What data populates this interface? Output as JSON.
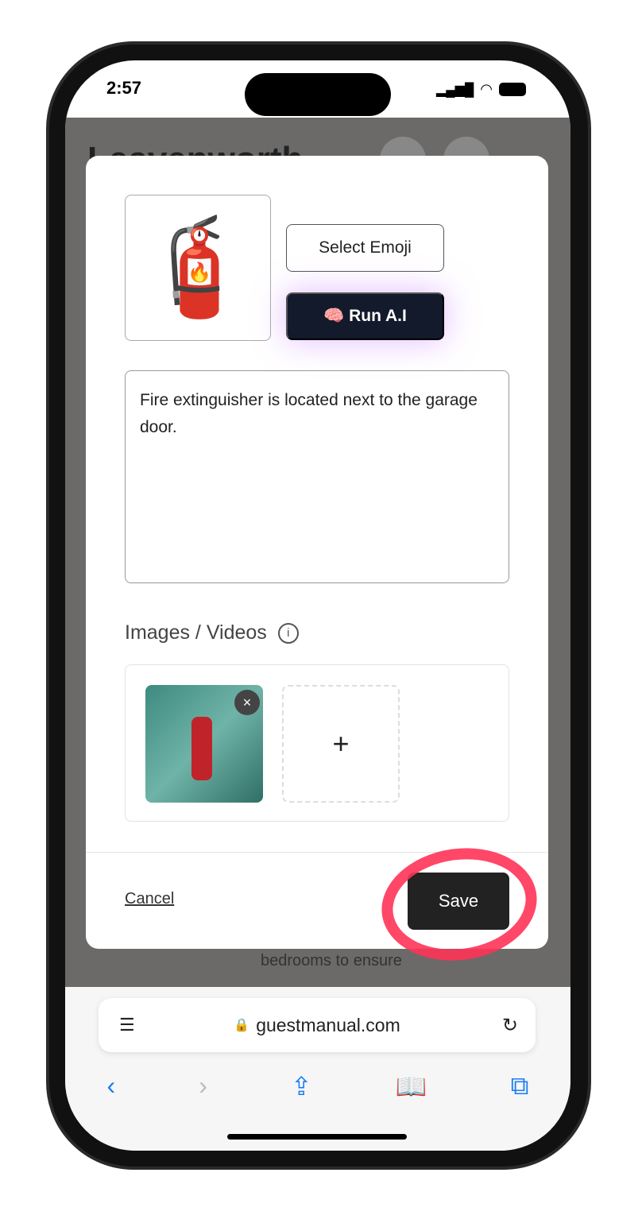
{
  "status": {
    "time": "2:57"
  },
  "background": {
    "title": "Leavenworth",
    "text": "bedrooms to ensure"
  },
  "modal": {
    "emoji": "🧯",
    "select_emoji": "Select Emoji",
    "run_ai": "Run A.I",
    "description": "Fire extinguisher is located next to the garage door.",
    "media_label": "Images / Videos",
    "add_label": "+",
    "remove_label": "×",
    "cancel": "Cancel",
    "save": "Save"
  },
  "browser": {
    "url": "guestmanual.com"
  },
  "colors": {
    "accent": "#ff3358",
    "ai_button": "#121a2b",
    "link": "#1a7cf5"
  }
}
